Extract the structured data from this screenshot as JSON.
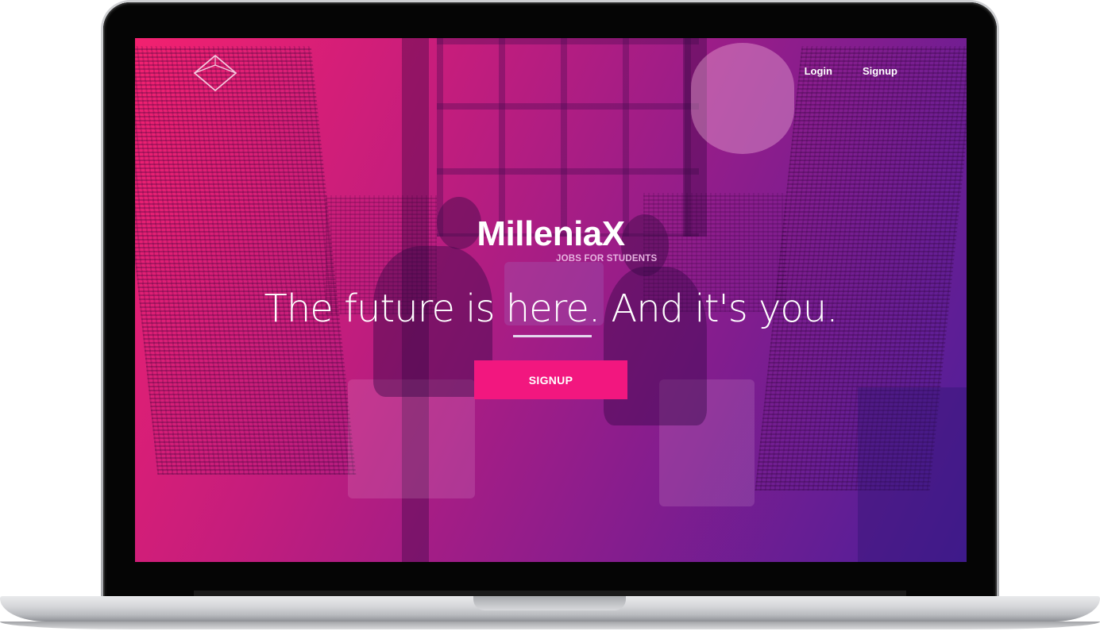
{
  "nav": {
    "login_label": "Login",
    "signup_label": "Signup"
  },
  "hero": {
    "brand": "MilleniaX",
    "tagline": "JOBS FOR STUDENTS",
    "headline": "The future is here. And it's you.",
    "cta_label": "SIGNUP"
  },
  "icons": {
    "logo": "diamond-outline-icon"
  },
  "colors": {
    "gradient_start": "#f2216f",
    "gradient_end": "#4a1e9a",
    "cta_background": "#f2177f",
    "tagline": "#e6b3e0",
    "text": "#ffffff"
  }
}
